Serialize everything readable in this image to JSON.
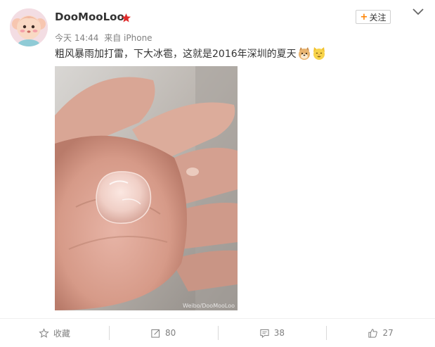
{
  "post": {
    "username": "DooMooLoo",
    "time": "今天 14:44",
    "source": "来自 iPhone",
    "text": "粗风暴雨加打雷，下大冰雹，这就是2016年深圳的夏天",
    "emojis": [
      "doge-dog-emoji",
      "cat-face-emoji"
    ],
    "follow_label": "关注",
    "photo": {
      "subject": "hand-holding-hailstone",
      "watermark": "Weibo/DooMooLoo"
    }
  },
  "actions": {
    "favorite_label": "收藏",
    "repost_count": "80",
    "comment_count": "38",
    "like_count": "27"
  },
  "colors": {
    "accent": "#ff8200",
    "vip_star": "#e02b2b",
    "meta_text": "#808080"
  }
}
